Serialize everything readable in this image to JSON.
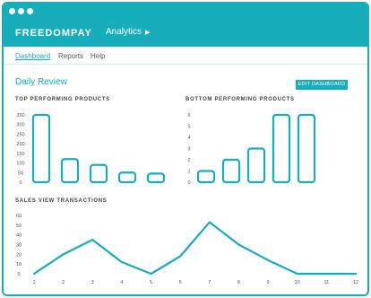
{
  "brand": {
    "logo": "FREEDOMPAY",
    "accent": "#17aebb"
  },
  "header": {
    "menu_label": "Analytics"
  },
  "nav": {
    "items": [
      "Dashboard",
      "Reports",
      "Help"
    ],
    "active": "Dashboard"
  },
  "page": {
    "title": "Daily Review",
    "edit_button": "EDIT DASHBOARD"
  },
  "sections": {
    "top": "TOP PERFORMING PRODUCTS",
    "bottom": "BOTTOM PERFORMING PRODUCTS",
    "sales": "SALES VIEW TRANSACTIONS"
  },
  "chart_data": [
    {
      "type": "bar",
      "title": "TOP PERFORMING PRODUCTS",
      "categories": [],
      "values": [
        350,
        120,
        90,
        50,
        45
      ],
      "ylim": [
        0,
        350
      ],
      "yticks": [
        0,
        50,
        100,
        150,
        200,
        250,
        300,
        350
      ]
    },
    {
      "type": "bar",
      "title": "BOTTOM PERFORMING PRODUCTS",
      "categories": [],
      "values": [
        1,
        2,
        3,
        6,
        6
      ],
      "ylim": [
        0,
        6
      ],
      "yticks": [
        0,
        1,
        2,
        3,
        4,
        5,
        6
      ]
    },
    {
      "type": "line",
      "title": "SALES VIEW TRANSACTIONS",
      "x": [
        1,
        2,
        3,
        4,
        5,
        6,
        7,
        8,
        9,
        10,
        11,
        12
      ],
      "values": [
        0,
        20,
        35,
        12,
        0,
        18,
        53,
        30,
        14,
        0,
        0,
        0
      ],
      "ylim": [
        0,
        60
      ],
      "yticks": [
        0,
        10,
        20,
        30,
        40,
        50,
        60
      ]
    }
  ]
}
